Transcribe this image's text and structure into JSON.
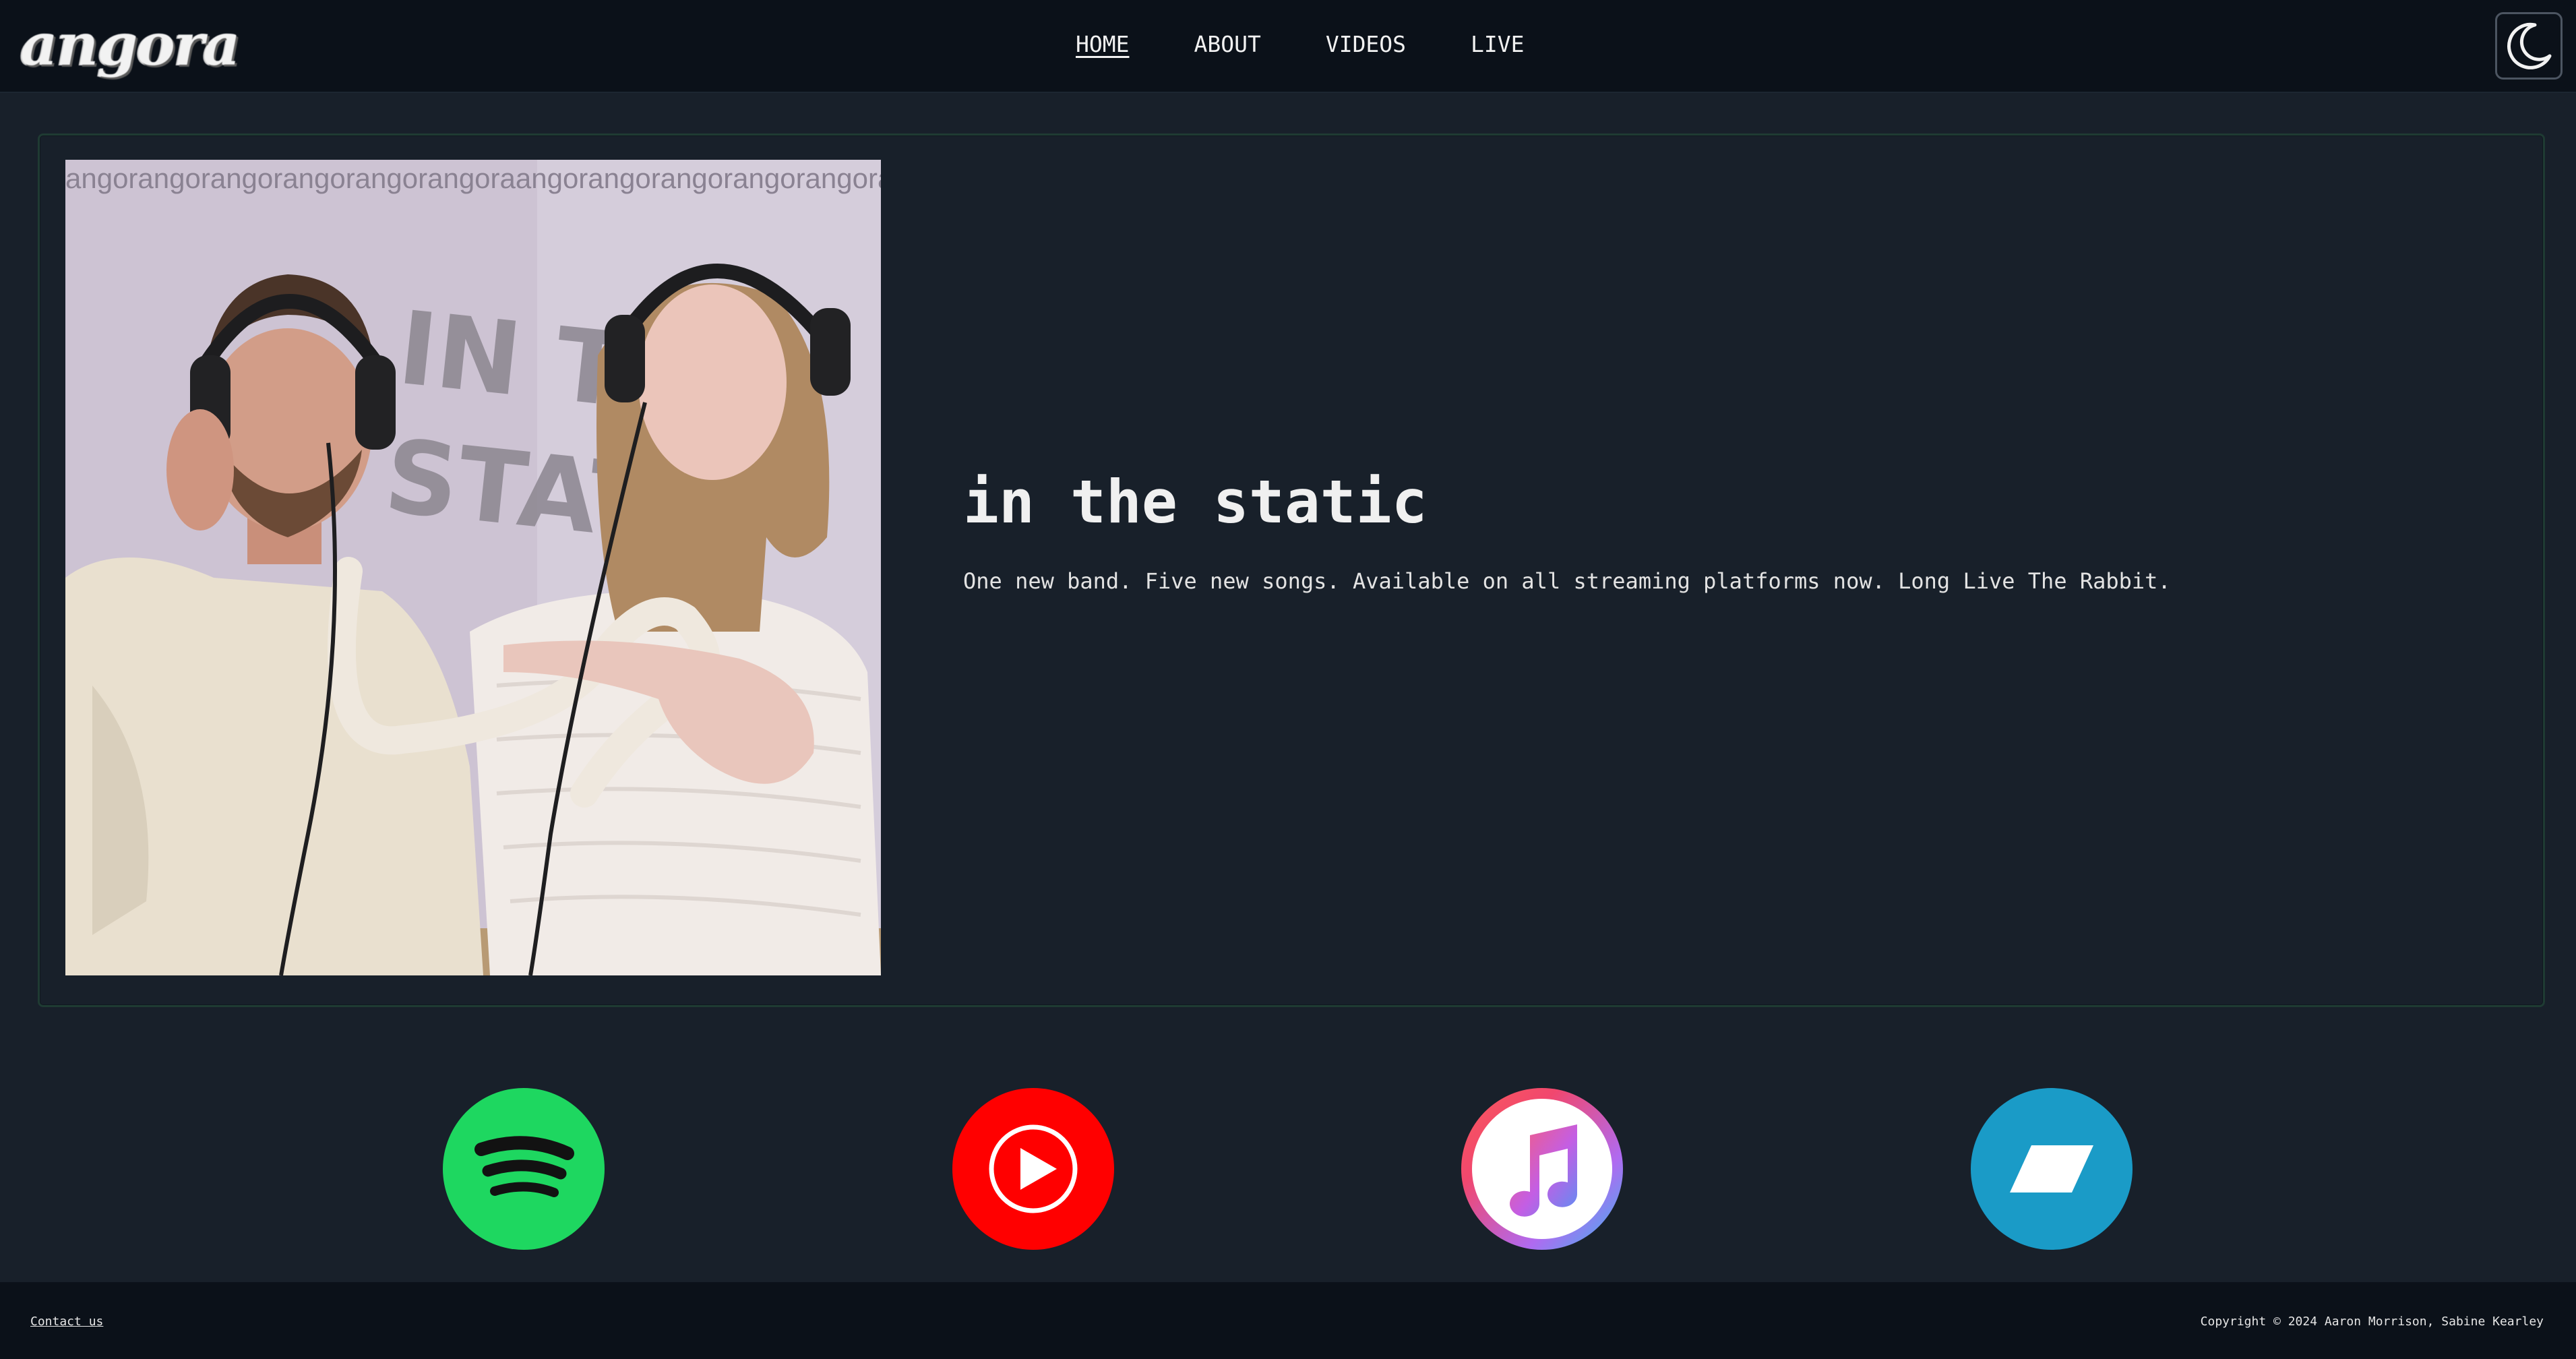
{
  "header": {
    "logo_text": "angora",
    "nav": [
      {
        "label": "HOME",
        "active": true
      },
      {
        "label": "ABOUT",
        "active": false
      },
      {
        "label": "VIDEOS",
        "active": false
      },
      {
        "label": "LIVE",
        "active": false
      }
    ],
    "theme_toggle_icon": "moon-icon"
  },
  "hero": {
    "album_art": {
      "banner_text": "angorangorangorangorangorangoraangorangorangorangorangorang",
      "banner_highlight": "angora",
      "cover_text_line1": "IN THE",
      "cover_text_line2": "STATIC"
    },
    "title": "in the static",
    "subtitle": "One new band. Five new songs. Available on all streaming platforms now. Long Live The Rabbit."
  },
  "streaming": [
    {
      "service": "spotify",
      "icon": "spotify-icon",
      "color": "#1ed760"
    },
    {
      "service": "youtube-music",
      "icon": "youtube-play-icon",
      "color": "#ff0000"
    },
    {
      "service": "apple-music",
      "icon": "apple-music-note-icon",
      "color": "#f1476e"
    },
    {
      "service": "bandcamp",
      "icon": "bandcamp-icon",
      "color": "#1a9bc7"
    }
  ],
  "footer": {
    "contact_label": "Contact us",
    "copyright": "Copyright © 2024 Aaron Morrison, Sabine Kearley"
  },
  "theme": {
    "background": "#18202a",
    "header_bg": "#0b1119",
    "card_border": "#1f3b33",
    "text": "#f0f0f0"
  }
}
